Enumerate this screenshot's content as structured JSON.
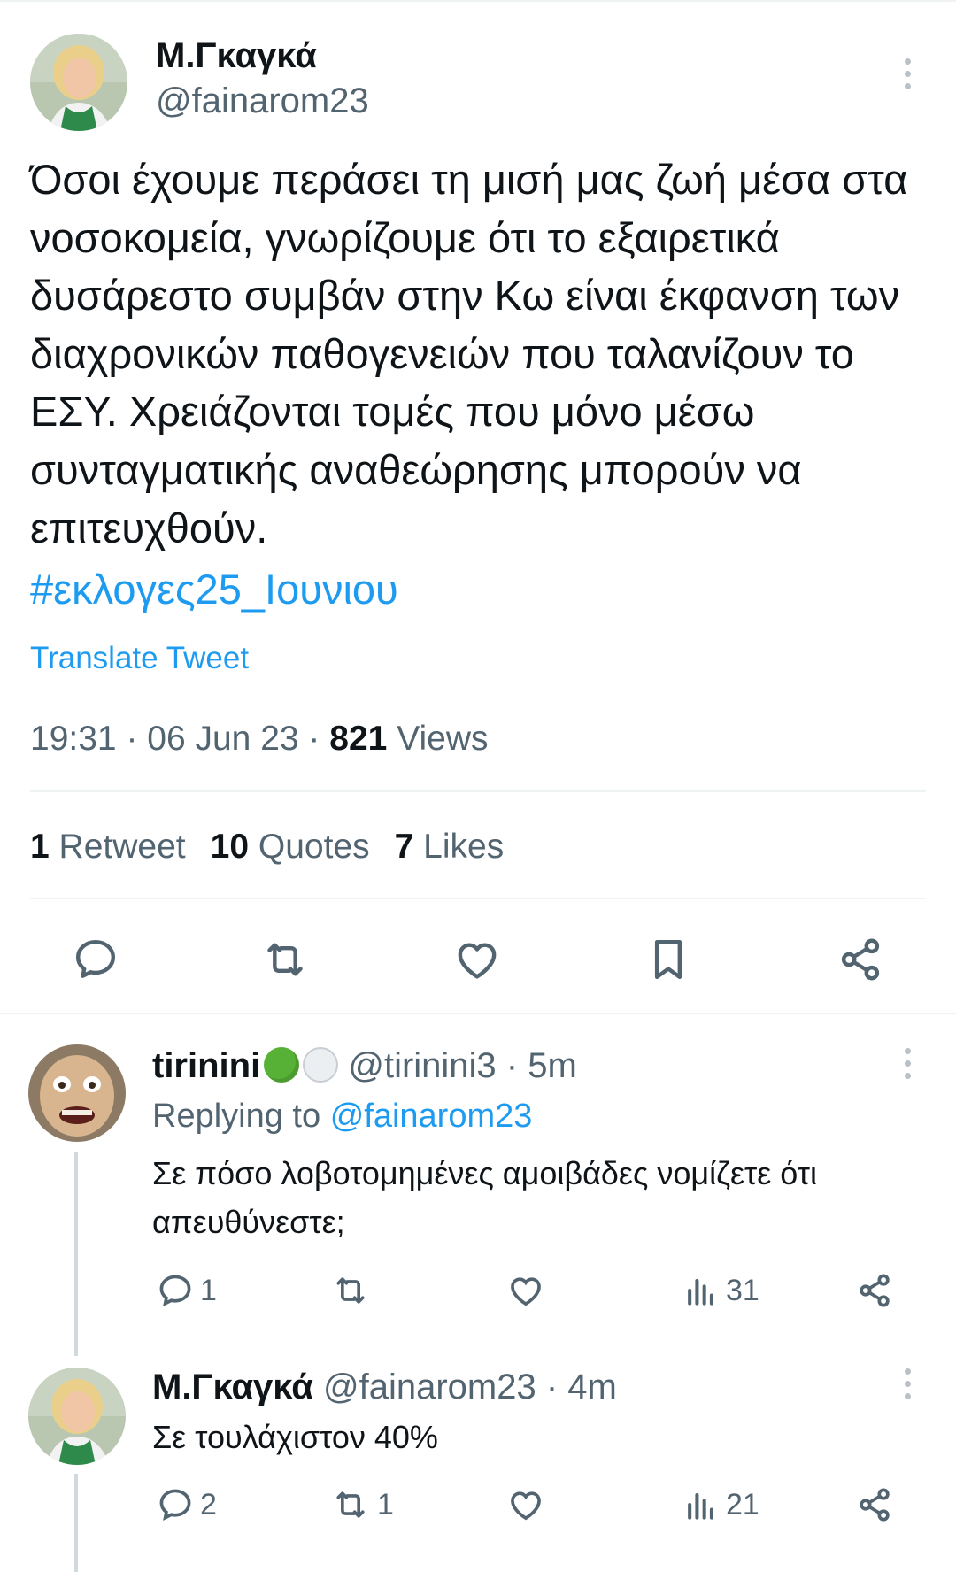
{
  "tweet": {
    "author_name": "Μ.Γκαγκά",
    "author_handle": "@fainarom23",
    "text": "Όσοι έχουμε περάσει τη μισή μας ζωή μέσα στα νοσοκομεία, γνωρίζουμε ότι το εξαιρετικά δυσάρεστο συμβάν στην Κω είναι έκφανση των διαχρονικών παθογενειών που ταλανίζουν το ΕΣΥ. Χρειάζονται τομές που μόνο μέσω συνταγματικής αναθεώρησης μπορούν να επιτευχθούν.",
    "hashtag": "#εκλογες25_Ιουνιου",
    "translate_label": "Translate Tweet",
    "time": "19:31",
    "date": "06 Jun 23",
    "views_count": "821",
    "views_label": "Views",
    "retweets_count": "1",
    "retweets_label": "Retweet",
    "quotes_count": "10",
    "quotes_label": "Quotes",
    "likes_count": "7",
    "likes_label": "Likes",
    "actions": [
      "reply-icon",
      "retweet-icon",
      "like-icon",
      "bookmark-icon",
      "share-icon"
    ]
  },
  "replies": [
    {
      "author_name": "tirinini",
      "emojis": [
        "green-circle",
        "white-circle"
      ],
      "author_handle": "@tirinini3",
      "age": "5m",
      "replying_prefix": "Replying to",
      "replying_to": "@fainarom23",
      "text": "Σε πόσο λοβοτομημένες αμοιβάδες νομίζετε ότι απευθύνεστε;",
      "reply_count": "1",
      "retweet_count": "",
      "like_count": "",
      "views": "31"
    },
    {
      "author_name": "Μ.Γκαγκά",
      "author_handle": "@fainarom23",
      "age": "4m",
      "text": "Σε τουλάχιστον 40%",
      "reply_count": "2",
      "retweet_count": "1",
      "like_count": "",
      "views": "21"
    }
  ],
  "colors": {
    "accent": "#1d9bf0",
    "text": "#0f1419",
    "secondary": "#536471",
    "divider": "#eff3f4"
  }
}
